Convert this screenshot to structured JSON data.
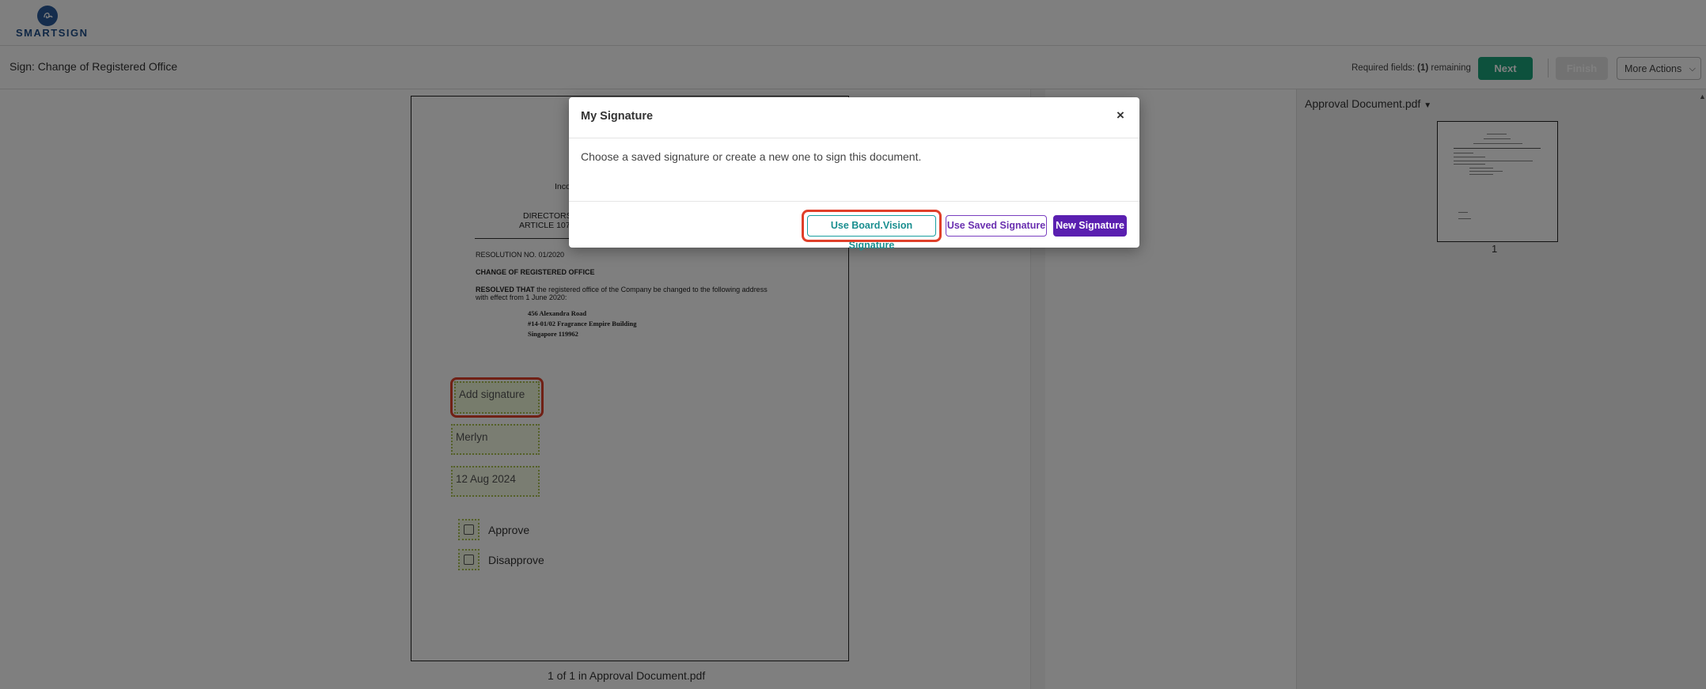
{
  "app": {
    "logo_text": "SMARTSIGN"
  },
  "header": {
    "title": "Sign: Change of Registered Office",
    "required_prefix": "Required fields: ",
    "required_count": "(1)",
    "required_suffix": " remaining",
    "next_label": "Next",
    "finish_label": "Finish",
    "more_actions_label": "More Actions"
  },
  "document": {
    "line_inco": "Inco",
    "line_directors": "DIRECTORS",
    "line_article": "ARTICLE 107",
    "resolution_no": "RESOLUTION NO. 01/2020",
    "heading": "CHANGE OF REGISTERED OFFICE",
    "resolved_bold": "RESOLVED THAT",
    "resolved_text": " the registered office of the Company be changed to the following address",
    "resolved_text2": "with effect from 1 June 2020:",
    "address": [
      "456 Alexandra Road",
      "#14-01/02 Fragrance Empire Building",
      "Singapore 119962"
    ],
    "fields": {
      "signature_placeholder": "Add signature",
      "name_value": "Merlyn",
      "date_value": "12 Aug 2024"
    },
    "options": {
      "approve": "Approve",
      "disapprove": "Disapprove"
    },
    "footer": "1 of 1 in Approval Document.pdf"
  },
  "thumbnails": {
    "file_name": "Approval Document.pdf",
    "pages": [
      "1"
    ]
  },
  "modal": {
    "title": "My Signature",
    "close_symbol": "×",
    "body": "Choose a saved signature or create a new one to sign this document.",
    "buttons": {
      "boardvision": "Use Board.Vision Signature",
      "saved": "Use Saved Signature",
      "new": "New Signature"
    }
  },
  "colors": {
    "brand_blue": "#1e4e8a",
    "next_green": "#1aa37a",
    "highlight_red": "#e0402a",
    "teal": "#1a9fa0",
    "purple": "#5a1fb0"
  }
}
